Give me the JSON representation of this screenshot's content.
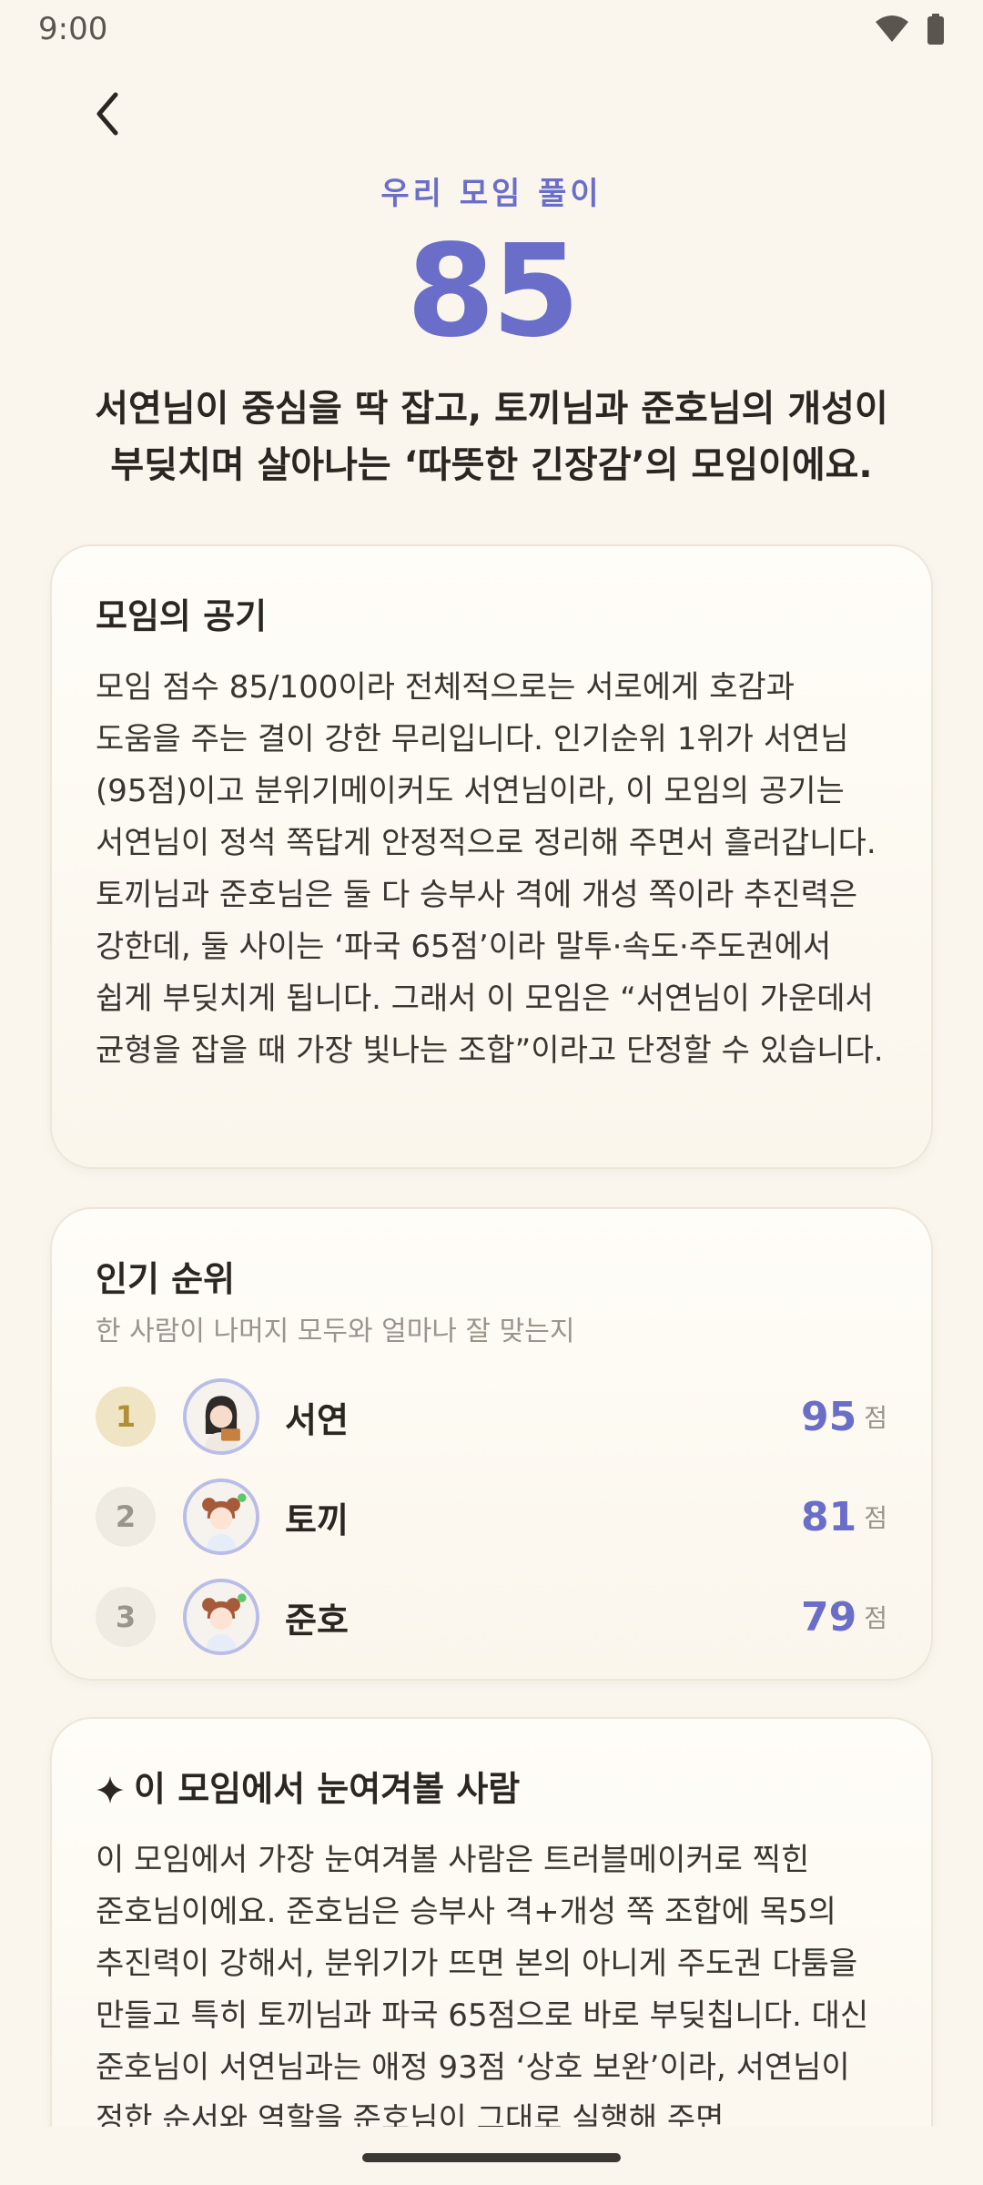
{
  "status_bar": {
    "time": "9:00",
    "icons": [
      "wifi-icon",
      "battery-icon"
    ]
  },
  "header": {
    "eyebrow": "우리 모임 풀이",
    "score": "85",
    "summary_line1": "서연님이 중심을 딱 잡고, 토끼님과 준호님의 개성이",
    "summary_line2": "부딪치며 살아나는 ‘따뜻한 긴장감’의 모임이에요."
  },
  "atmosphere": {
    "title": "모임의 공기",
    "body": "모임 점수 85/100이라 전체적으로는 서로에게 호감과 도움을 주는 결이 강한 무리입니다. 인기순위 1위가 서연님(95점)이고 분위기메이커도 서연님이라, 이 모임의 공기는 서연님이 정석 쪽답게 안정적으로 정리해 주면서 흘러갑니다. 토끼님과 준호님은 둘 다 승부사 격에 개성 쪽이라 추진력은 강한데, 둘 사이는 ‘파국 65점’이라 말투·속도·주도권에서 쉽게 부딪치게 됩니다. 그래서 이 모임은 “서연님이 가운데서 균형을 잡을 때 가장 빛나는 조합”이라고 단정할 수 있습니다."
  },
  "ranking": {
    "title": "인기 순위",
    "subtitle": "한 사람이 나머지 모두와 얼마나 잘 맞는지",
    "score_unit": "점",
    "members": [
      {
        "rank": "1",
        "name": "서연",
        "score": "95"
      },
      {
        "rank": "2",
        "name": "토끼",
        "score": "81"
      },
      {
        "rank": "3",
        "name": "준호",
        "score": "79"
      }
    ]
  },
  "highlight": {
    "icon": "sparkle-icon",
    "title": "이 모임에서 눈여겨볼 사람",
    "body": "이 모임에서 가장 눈여겨볼 사람은 트러블메이커로 찍힌 준호님이에요. 준호님은 승부사 격+개성 쪽 조합에 목5의 추진력이 강해서, 분위기가 뜨면 본의 아니게 주도권 다툼을 만들고 특히 토끼님과 파국 65점으로 바로 부딪칩니다. 대신 준호님이 서연님과는 애정 93점 ‘상호 보완’이라, 서연님이 정한 순서와 역할을 준호님이 그대로 실행해 주면"
  },
  "colors": {
    "accent": "#6a6ec8",
    "background": "#faf6ee",
    "gold_badge": "#efe4c4"
  }
}
